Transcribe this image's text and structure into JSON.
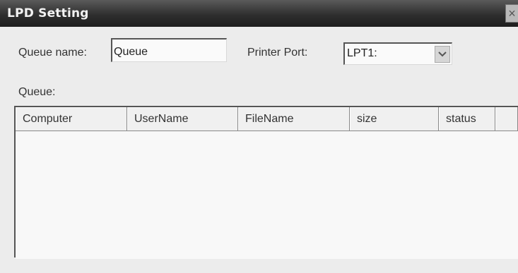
{
  "window": {
    "title": "LPD Setting",
    "close_glyph": "×"
  },
  "queue_name": {
    "label": "Queue name:",
    "value": "Queue"
  },
  "printer_port": {
    "label": "Printer Port:",
    "selected": "LPT1:"
  },
  "queue_list": {
    "label": "Queue:",
    "columns": [
      "Computer",
      "UserName",
      "FileName",
      "size",
      "status"
    ],
    "rows": []
  },
  "icons": {
    "close": "close-icon",
    "dropdown": "chevron-down-icon"
  }
}
